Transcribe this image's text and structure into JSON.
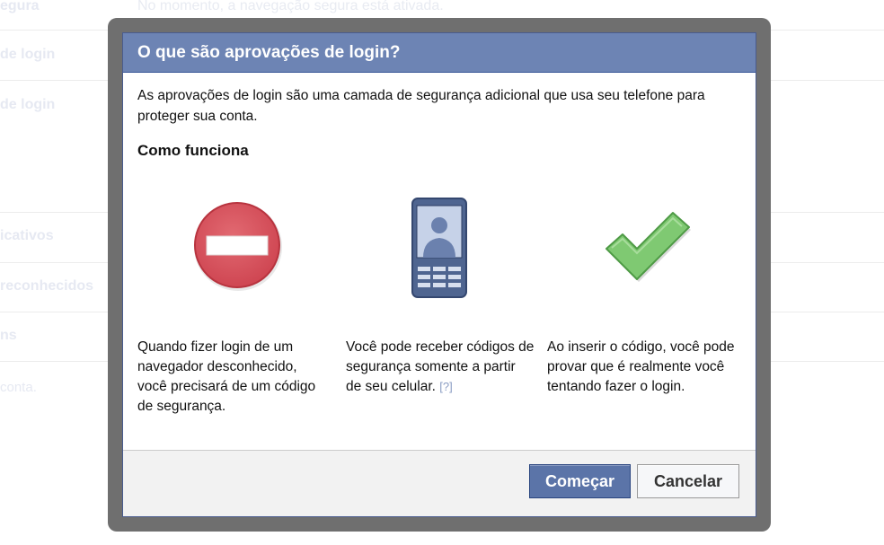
{
  "background": {
    "rows": [
      {
        "label": "egura",
        "value": "No momento, a navegação segura está ativada."
      },
      {
        "label": "de login",
        "value": ""
      },
      {
        "label": "de login",
        "value": ""
      },
      {
        "label": "icativos",
        "value": ""
      },
      {
        "label": "reconhecidos",
        "value": ""
      },
      {
        "label": "ns",
        "value": ""
      }
    ],
    "footer_text": "conta."
  },
  "dialog": {
    "title": "O que são aprovações de login?",
    "intro": "As aprovações de login são uma camada de segurança adicional que usa seu telefone para proteger sua conta.",
    "section_heading": "Como funciona",
    "steps": [
      {
        "icon": "no-entry-icon",
        "text": "Quando fizer login de um navegador desconhecido, você precisará de um código de segurança."
      },
      {
        "icon": "mobile-phone-icon",
        "text": "Você pode receber códigos de segurança somente a partir de seu celular.",
        "help": "[?]"
      },
      {
        "icon": "checkmark-icon",
        "text": "Ao inserir o código, você pode provar que é realmente você tentando fazer o login."
      }
    ],
    "buttons": {
      "primary": "Começar",
      "secondary": "Cancelar"
    }
  },
  "colors": {
    "header_blue": "#6d84b4",
    "button_blue": "#5b74a8",
    "stop_red": "#d8505a",
    "check_green": "#7bc56f"
  }
}
